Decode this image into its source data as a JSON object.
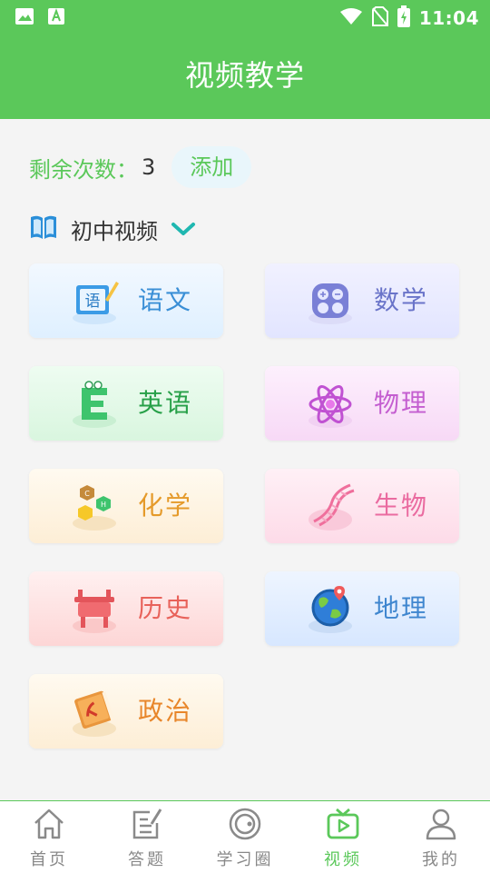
{
  "status_bar": {
    "time": "11:04"
  },
  "app_bar": {
    "title": "视频教学"
  },
  "remaining": {
    "label": "剩余次数：",
    "value": "3",
    "add_label": "添加"
  },
  "level": {
    "label": "初中视频"
  },
  "subjects": [
    {
      "label": "语文",
      "icon": "chinese-book-icon",
      "text_color": "#3a8fd6"
    },
    {
      "label": "数学",
      "icon": "calculator-icon",
      "text_color": "#6a74c9"
    },
    {
      "label": "英语",
      "icon": "english-letter-icon",
      "text_color": "#27a048"
    },
    {
      "label": "物理",
      "icon": "atom-icon",
      "text_color": "#c45ed0"
    },
    {
      "label": "化学",
      "icon": "chemistry-molecule-icon",
      "text_color": "#e59a2a"
    },
    {
      "label": "生物",
      "icon": "dna-icon",
      "text_color": "#ea6ba0"
    },
    {
      "label": "历史",
      "icon": "ancient-cauldron-icon",
      "text_color": "#e8625a"
    },
    {
      "label": "地理",
      "icon": "globe-icon",
      "text_color": "#3f86cf"
    },
    {
      "label": "政治",
      "icon": "politics-book-icon",
      "text_color": "#e8862a"
    }
  ],
  "tabs": [
    {
      "label": "首页",
      "icon": "home-icon"
    },
    {
      "label": "答题",
      "icon": "quiz-edit-icon"
    },
    {
      "label": "学习圈",
      "icon": "study-circle-icon"
    },
    {
      "label": "视频",
      "icon": "video-tv-icon",
      "active": true
    },
    {
      "label": "我的",
      "icon": "profile-icon"
    }
  ],
  "colors": {
    "brand_green": "#5bc85a"
  }
}
